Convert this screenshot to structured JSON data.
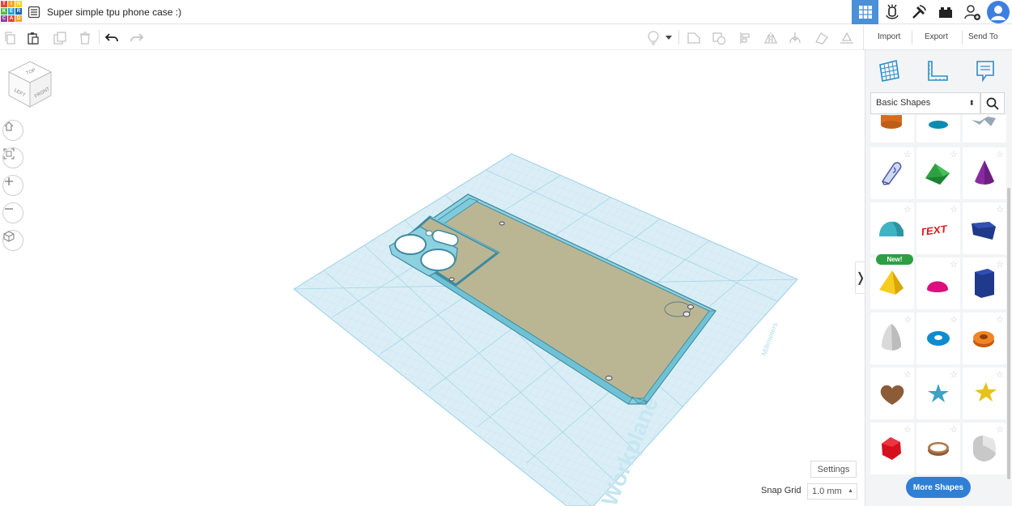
{
  "app": {
    "logo_letters": [
      "T",
      "I",
      "N",
      "K",
      "E",
      "R",
      "C",
      "A",
      "D"
    ],
    "logo_colors": [
      "#e2473b",
      "#f6a623",
      "#f8d30f",
      "#57b848",
      "#2d9fd8",
      "#1d66b0",
      "#8b3fa0",
      "#e2473b",
      "#f6a623"
    ],
    "accent_color": "#4a90d9",
    "document_title": "Super simple tpu phone case :)"
  },
  "topbar": {
    "icons": [
      "designs-list-icon",
      "3d-view-icon",
      "ar-view-icon",
      "codeblocks-icon",
      "bricks-icon",
      "add-user-icon",
      "user-avatar-icon"
    ]
  },
  "toolbar": {
    "icons": [
      "copy-icon",
      "paste-icon",
      "duplicate-icon",
      "delete-icon",
      "undo-icon",
      "redo-icon",
      "light-bulb-icon",
      "dropdown-arrow-icon",
      "group-icon",
      "ungroup-icon",
      "align-icon",
      "mirror-icon",
      "cruise-icon",
      "flip-icon",
      "workplane-drop-icon"
    ]
  },
  "right_tabs": {
    "import": "Import",
    "export": "Export",
    "send_to": "Send To"
  },
  "viewcube": {
    "top": "TOP",
    "left": "LEFT",
    "front": "FRONT"
  },
  "nav_buttons": [
    "home-view-icon",
    "fit-view-icon",
    "zoom-in-icon",
    "zoom-out-icon",
    "perspective-icon"
  ],
  "workplane": {
    "label": "Workplane",
    "units": "Millimeters",
    "plane_color": "#dbeef6",
    "grid_color": "#9ccfe3",
    "case_color": "#6bc3d6",
    "case_fill": "#bab694"
  },
  "bottom": {
    "settings": "Settings",
    "snap_grid_label": "Snap Grid",
    "snap_grid_value": "1.0 mm"
  },
  "panel": {
    "shape_library": "Basic Shapes",
    "new_badge": "New!",
    "more_shapes": "More Shapes",
    "tiles": [
      "cylinder-shape",
      "round-roof-shape",
      "paper-shape",
      "scribble-shape",
      "roof-shape",
      "cone-shape",
      "half-cylinder-shape",
      "text-shape",
      "polygon-shape",
      "pyramid-shape",
      "half-sphere-shape",
      "polygon-prism-shape",
      "paraboloid-shape",
      "torus-shape",
      "tube-shape",
      "heart-shape",
      "star-shape",
      "star-thick-shape",
      "icosahedron-shape",
      "ring-shape",
      "box-rounded-shape"
    ],
    "text_shape_label": "TEXT"
  }
}
